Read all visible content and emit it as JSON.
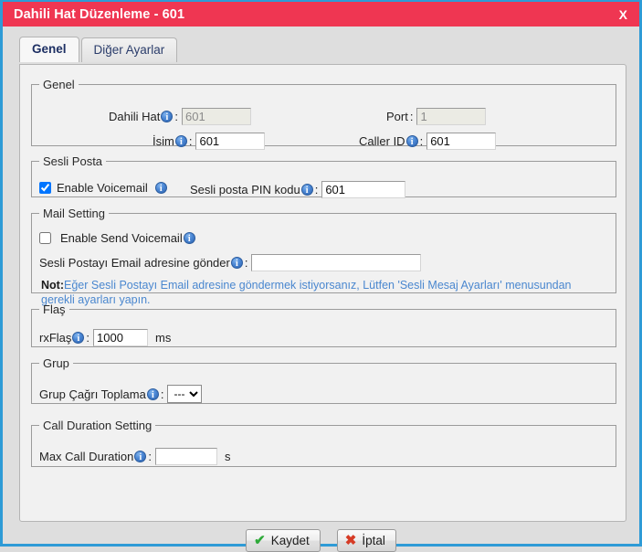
{
  "window": {
    "title": "Dahili Hat Düzenleme - 601",
    "close_label": "X",
    "titlebar_color": "#ef3652",
    "border_color": "#2e9bd6"
  },
  "tabs": [
    {
      "label": "Genel",
      "active": true
    },
    {
      "label": "Diğer Ayarlar",
      "active": false
    }
  ],
  "sections": {
    "genel": {
      "legend": "Genel",
      "dahili_hat": {
        "label": "Dahili Hat",
        "value": "601",
        "info": "i",
        "disabled": true
      },
      "port": {
        "label": "Port",
        "value": "1",
        "disabled": true
      },
      "isim": {
        "label": "İsim",
        "value": "601",
        "info": "i",
        "disabled": false
      },
      "caller_id": {
        "label": "Caller ID",
        "value": "601",
        "info": "i",
        "disabled": false
      }
    },
    "sesli_posta": {
      "legend": "Sesli Posta",
      "enable_voicemail": {
        "label": "Enable Voicemail",
        "checked": true,
        "info": "i"
      },
      "pin": {
        "label": "Sesli posta PIN kodu",
        "value": "601",
        "info": "i"
      }
    },
    "mail_setting": {
      "legend": "Mail Setting",
      "enable_send_voicemail": {
        "label": "Enable Send Voicemail",
        "checked": false,
        "info": "i"
      },
      "email": {
        "label": "Sesli Postayı Email adresine gönder",
        "value": "",
        "info": "i"
      },
      "note_prefix": "Not:",
      "note_text": "Eğer Sesli Postayı Email adresine göndermek istiyorsanız, Lütfen 'Sesli Mesaj Ayarları' menusundan gerekli ayarları yapın.",
      "note_color": "#4a87cf"
    },
    "flas": {
      "legend": "Flaş",
      "rxflas": {
        "label": "rxFlaş",
        "value": "1000",
        "unit": "ms",
        "info": "i"
      }
    },
    "grup": {
      "legend": "Grup",
      "grup_cagri_toplama": {
        "label": "Grup Çağrı Toplama",
        "selected": "---",
        "options": [
          "---"
        ],
        "info": "i"
      }
    },
    "call_duration": {
      "legend": "Call Duration Setting",
      "max_call_duration": {
        "label": "Max Call Duration",
        "value": "",
        "unit": "s",
        "info": "i"
      }
    }
  },
  "footer": {
    "save": {
      "label": "Kaydet",
      "icon": "check-icon",
      "glyph": "✔",
      "color": "#2faa3a"
    },
    "cancel": {
      "label": "İptal",
      "icon": "cross-icon",
      "glyph": "✖",
      "color": "#d63b25"
    }
  }
}
